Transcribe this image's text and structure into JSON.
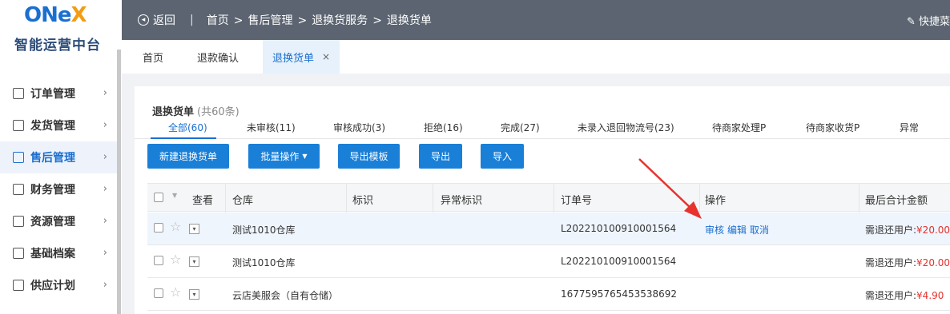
{
  "brand": {
    "logo_on": "ON",
    "logo_e": "e",
    "logo_x": "X",
    "platform": "智能运营中台"
  },
  "sidebar": {
    "items": [
      {
        "label": "订单管理",
        "active": false
      },
      {
        "label": "发货管理",
        "active": false
      },
      {
        "label": "售后管理",
        "active": true
      },
      {
        "label": "财务管理",
        "active": false
      },
      {
        "label": "资源管理",
        "active": false
      },
      {
        "label": "基础档案",
        "active": false
      },
      {
        "label": "供应计划",
        "active": false
      }
    ]
  },
  "topbar": {
    "back": "返回",
    "divider": "|",
    "breadcrumb": [
      "首页",
      "售后管理",
      "退换货服务",
      "退换货单"
    ],
    "quick": "快捷菜"
  },
  "tabs": [
    {
      "label": "首页"
    },
    {
      "label": "退款确认"
    },
    {
      "label": "退换货单",
      "active": true,
      "close": "×"
    }
  ],
  "page": {
    "title": "退换货单",
    "count": "(共60条)",
    "status_tabs": [
      "全部(60)",
      "未审核(11)",
      "审核成功(3)",
      "拒绝(16)",
      "完成(27)",
      "未录入退回物流号(23)",
      "待商家处理P",
      "待商家收货P",
      "异常"
    ],
    "buttons": {
      "new": "新建退换货单",
      "batch": "批量操作",
      "export_template": "导出模板",
      "export": "导出",
      "import": "导入"
    }
  },
  "table": {
    "headers": {
      "view": "查看",
      "warehouse": "仓库",
      "flag": "标识",
      "abnormal": "异常标识",
      "order_no": "订单号",
      "actions": "操作",
      "total": "最后合计金额"
    },
    "rows": [
      {
        "warehouse": "测试1010仓库",
        "order_no": "L202210100910001564",
        "ops": [
          "审核",
          "编辑",
          "取消"
        ],
        "refund_label": "需退还用户:",
        "refund_value": "¥20.00"
      },
      {
        "warehouse": "测试1010仓库",
        "order_no": "L202210100910001564",
        "ops": [],
        "refund_label": "需退还用户:",
        "refund_value": "¥20.00"
      },
      {
        "warehouse": "云店美服会（自有仓储）",
        "order_no": "1677595765453538692",
        "ops": [],
        "refund_label": "需退还用户:",
        "refund_value": "¥4.90"
      }
    ]
  },
  "colors": {
    "accent": "#1a7fd7",
    "topbar": "#5b6470",
    "money": "#e6312d",
    "annotation_arrow": "#e8322d"
  },
  "icons": {
    "star": "☆",
    "expand": "▾",
    "chevron": "›",
    "pin": "📌"
  }
}
